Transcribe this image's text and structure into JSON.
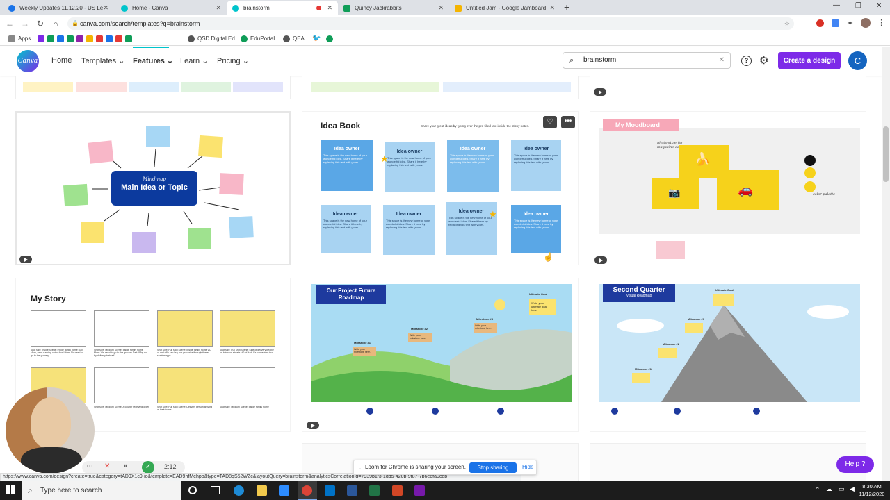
{
  "browser": {
    "tabs": [
      {
        "title": "Weekly Updates 11.12.20 - US Le",
        "color": "#1a73e8"
      },
      {
        "title": "Home - Canva",
        "color": "#00c4cc"
      },
      {
        "title": "brainstorm",
        "color": "#00c4cc"
      },
      {
        "title": "Quincy Jackrabbits",
        "color": "#0f9d58"
      },
      {
        "title": "Untitled Jam - Google Jamboard",
        "color": "#f4b400"
      }
    ],
    "url": "canva.com/search/templates?q=brainstorm",
    "bookmarks": [
      "Apps",
      "QSD Digital Ed",
      "EduPortal",
      "QEA"
    ]
  },
  "canva": {
    "logo": "Canva",
    "nav": {
      "home": "Home",
      "templates": "Templates",
      "features": "Features",
      "learn": "Learn",
      "pricing": "Pricing"
    },
    "search_value": "brainstorm",
    "create_label": "Create a design",
    "avatar_letter": "C"
  },
  "cards": {
    "mindmap": {
      "script": "Mindmap",
      "title": "Main Idea or Topic"
    },
    "ideabook": {
      "title": "Idea Book",
      "subtitle": "Share your great ideas by typing over the pre-filled text inside the sticky notes.",
      "owner": "Idea owner",
      "body": "This space is the new home of your wonderful idea. Share it here by replacing this text with yours."
    },
    "moodboard": {
      "title": "My Moodboard",
      "script": "photo style for magazine cover",
      "palette": "color palette"
    },
    "mystory": {
      "title": "My Story",
      "captions": [
        "Shot size: Inside Scene: Inside family home Day Mom, were running out of food Mom: No need to go to the grocery.",
        "Shot size: Medium Scene: Inside family home Mom: We need to go to the grocery Dad: Why not try delivery instead?",
        "Shot size: Full shot Scene: Inside family home VO of dad: We can buy our groceries through these service apps.",
        "Shot size: Full shot Scene: Side of delivery people on bikes on streets VO of dad: It's convenient too.",
        "Shot size: Full shot Scene: A courier picking up order from shop",
        "Shot size: Medium Scene: A courier receiving order",
        "Shot size: Full shot Scene: Delivery person arriving at their home",
        "Shot size: Medium Scene: Inside family home"
      ]
    },
    "roadmap": {
      "title": "Our Project Future Roadmap",
      "goal": "Ultimate Goal",
      "milestones": [
        "Milestone #1",
        "Milestone #2",
        "Milestone #3"
      ],
      "milestone_note": "Write your milestone here.",
      "goal_note": "Write your ultimate goal here."
    },
    "quarter": {
      "title": "Second Quarter",
      "subtitle": "Visual Roadmap",
      "goal": "Ultimate Goal",
      "milestones": [
        "Milestone #1",
        "Milestone #2",
        "Milestone #3"
      ]
    }
  },
  "loom": {
    "sharing_text": "Loom for Chrome is sharing your screen.",
    "stop_label": "Stop sharing",
    "hide_label": "Hide",
    "timer": "2:12"
  },
  "status_url": "https://www.canva.com/design?create=true&category=tAD9X1c9-io&template=EAD9hfMehpo&type=TAD8qS52WZc&layoutQuery=brainstorm&analyticsCorrelationId=7939b1f3-1dd5-420b-9f87-7b6e6fa0ceb",
  "help_label": "Help ?",
  "taskbar": {
    "search_placeholder": "Type here to search",
    "time": "8:30 AM",
    "date": "11/12/2020"
  }
}
